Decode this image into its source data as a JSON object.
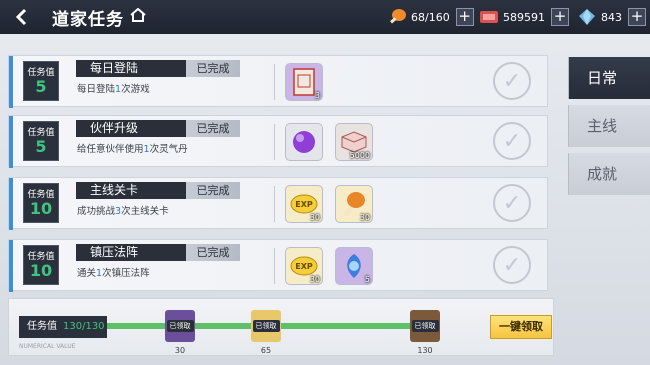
{
  "header": {
    "title": "道家任务",
    "resources": [
      {
        "icon": "drumstick-icon",
        "value": "68/160"
      },
      {
        "icon": "red-envelope-icon",
        "value": "589591"
      },
      {
        "icon": "crystal-icon",
        "value": "843"
      }
    ]
  },
  "tasks": [
    {
      "value_label": "任务值",
      "value": "5",
      "name": "每日登陆",
      "status": "已完成",
      "desc_pre": "每日登陆",
      "desc_hl": "1",
      "desc_post": "次游戏",
      "rewards": [
        {
          "icon": "scroll-card-icon",
          "count": "3"
        }
      ]
    },
    {
      "value_label": "任务值",
      "value": "5",
      "name": "伙伴升级",
      "status": "已完成",
      "desc_pre": "给任意伙伴使用",
      "desc_hl": "1",
      "desc_post": "次灵气丹",
      "rewards": [
        {
          "icon": "purple-orb-icon",
          "count": ""
        },
        {
          "icon": "silver-ingot-icon",
          "count": "5000"
        }
      ]
    },
    {
      "value_label": "任务值",
      "value": "10",
      "name": "主线关卡",
      "status": "已完成",
      "desc_pre": "成功挑战",
      "desc_hl": "3",
      "desc_post": "次主线关卡",
      "rewards": [
        {
          "icon": "exp-icon",
          "count": "30"
        },
        {
          "icon": "drumstick-icon",
          "count": "30"
        }
      ]
    },
    {
      "value_label": "任务值",
      "value": "10",
      "name": "镇压法阵",
      "status": "已完成",
      "desc_pre": "通关",
      "desc_hl": "1",
      "desc_post": "次镇压法阵",
      "rewards": [
        {
          "icon": "exp-icon",
          "count": "30"
        },
        {
          "icon": "blue-spirit-icon",
          "count": "5"
        }
      ]
    }
  ],
  "tabs": [
    {
      "label": "日常",
      "active": true
    },
    {
      "label": "主线",
      "active": false
    },
    {
      "label": "成就",
      "active": false
    }
  ],
  "progress": {
    "label": "任务值",
    "value": "130/130",
    "sublabel": "NUMERICAL VALUE",
    "fraction": 1.0,
    "milestones": [
      {
        "tag": "已领取",
        "num": "30"
      },
      {
        "tag": "已领取",
        "num": "65"
      },
      {
        "tag": "已领取",
        "num": "130"
      }
    ],
    "claim_all": "一键领取"
  },
  "colors": {
    "accent_blue": "#3d8fd6",
    "value_green": "#3ec47e",
    "claim_yellow": "#f5c440"
  }
}
